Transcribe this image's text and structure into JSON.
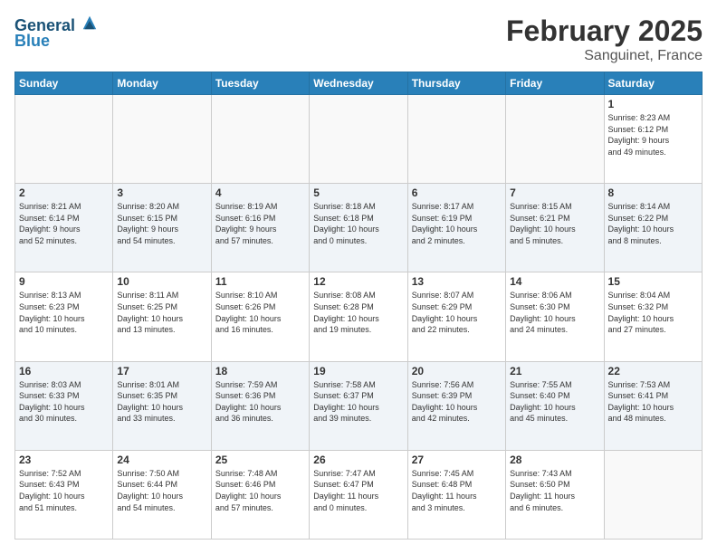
{
  "header": {
    "logo_line1": "General",
    "logo_line2": "Blue",
    "title": "February 2025",
    "subtitle": "Sanguinet, France"
  },
  "days_of_week": [
    "Sunday",
    "Monday",
    "Tuesday",
    "Wednesday",
    "Thursday",
    "Friday",
    "Saturday"
  ],
  "weeks": [
    [
      {
        "day": "",
        "info": ""
      },
      {
        "day": "",
        "info": ""
      },
      {
        "day": "",
        "info": ""
      },
      {
        "day": "",
        "info": ""
      },
      {
        "day": "",
        "info": ""
      },
      {
        "day": "",
        "info": ""
      },
      {
        "day": "1",
        "info": "Sunrise: 8:23 AM\nSunset: 6:12 PM\nDaylight: 9 hours\nand 49 minutes."
      }
    ],
    [
      {
        "day": "2",
        "info": "Sunrise: 8:21 AM\nSunset: 6:14 PM\nDaylight: 9 hours\nand 52 minutes."
      },
      {
        "day": "3",
        "info": "Sunrise: 8:20 AM\nSunset: 6:15 PM\nDaylight: 9 hours\nand 54 minutes."
      },
      {
        "day": "4",
        "info": "Sunrise: 8:19 AM\nSunset: 6:16 PM\nDaylight: 9 hours\nand 57 minutes."
      },
      {
        "day": "5",
        "info": "Sunrise: 8:18 AM\nSunset: 6:18 PM\nDaylight: 10 hours\nand 0 minutes."
      },
      {
        "day": "6",
        "info": "Sunrise: 8:17 AM\nSunset: 6:19 PM\nDaylight: 10 hours\nand 2 minutes."
      },
      {
        "day": "7",
        "info": "Sunrise: 8:15 AM\nSunset: 6:21 PM\nDaylight: 10 hours\nand 5 minutes."
      },
      {
        "day": "8",
        "info": "Sunrise: 8:14 AM\nSunset: 6:22 PM\nDaylight: 10 hours\nand 8 minutes."
      }
    ],
    [
      {
        "day": "9",
        "info": "Sunrise: 8:13 AM\nSunset: 6:23 PM\nDaylight: 10 hours\nand 10 minutes."
      },
      {
        "day": "10",
        "info": "Sunrise: 8:11 AM\nSunset: 6:25 PM\nDaylight: 10 hours\nand 13 minutes."
      },
      {
        "day": "11",
        "info": "Sunrise: 8:10 AM\nSunset: 6:26 PM\nDaylight: 10 hours\nand 16 minutes."
      },
      {
        "day": "12",
        "info": "Sunrise: 8:08 AM\nSunset: 6:28 PM\nDaylight: 10 hours\nand 19 minutes."
      },
      {
        "day": "13",
        "info": "Sunrise: 8:07 AM\nSunset: 6:29 PM\nDaylight: 10 hours\nand 22 minutes."
      },
      {
        "day": "14",
        "info": "Sunrise: 8:06 AM\nSunset: 6:30 PM\nDaylight: 10 hours\nand 24 minutes."
      },
      {
        "day": "15",
        "info": "Sunrise: 8:04 AM\nSunset: 6:32 PM\nDaylight: 10 hours\nand 27 minutes."
      }
    ],
    [
      {
        "day": "16",
        "info": "Sunrise: 8:03 AM\nSunset: 6:33 PM\nDaylight: 10 hours\nand 30 minutes."
      },
      {
        "day": "17",
        "info": "Sunrise: 8:01 AM\nSunset: 6:35 PM\nDaylight: 10 hours\nand 33 minutes."
      },
      {
        "day": "18",
        "info": "Sunrise: 7:59 AM\nSunset: 6:36 PM\nDaylight: 10 hours\nand 36 minutes."
      },
      {
        "day": "19",
        "info": "Sunrise: 7:58 AM\nSunset: 6:37 PM\nDaylight: 10 hours\nand 39 minutes."
      },
      {
        "day": "20",
        "info": "Sunrise: 7:56 AM\nSunset: 6:39 PM\nDaylight: 10 hours\nand 42 minutes."
      },
      {
        "day": "21",
        "info": "Sunrise: 7:55 AM\nSunset: 6:40 PM\nDaylight: 10 hours\nand 45 minutes."
      },
      {
        "day": "22",
        "info": "Sunrise: 7:53 AM\nSunset: 6:41 PM\nDaylight: 10 hours\nand 48 minutes."
      }
    ],
    [
      {
        "day": "23",
        "info": "Sunrise: 7:52 AM\nSunset: 6:43 PM\nDaylight: 10 hours\nand 51 minutes."
      },
      {
        "day": "24",
        "info": "Sunrise: 7:50 AM\nSunset: 6:44 PM\nDaylight: 10 hours\nand 54 minutes."
      },
      {
        "day": "25",
        "info": "Sunrise: 7:48 AM\nSunset: 6:46 PM\nDaylight: 10 hours\nand 57 minutes."
      },
      {
        "day": "26",
        "info": "Sunrise: 7:47 AM\nSunset: 6:47 PM\nDaylight: 11 hours\nand 0 minutes."
      },
      {
        "day": "27",
        "info": "Sunrise: 7:45 AM\nSunset: 6:48 PM\nDaylight: 11 hours\nand 3 minutes."
      },
      {
        "day": "28",
        "info": "Sunrise: 7:43 AM\nSunset: 6:50 PM\nDaylight: 11 hours\nand 6 minutes."
      },
      {
        "day": "",
        "info": ""
      }
    ]
  ]
}
